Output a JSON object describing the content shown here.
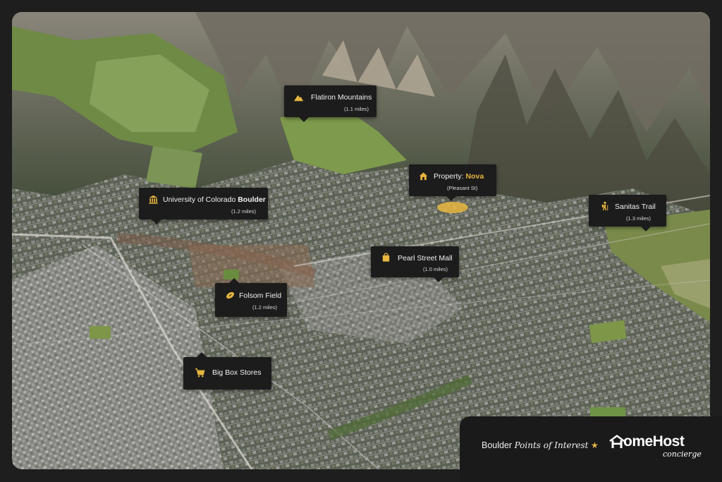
{
  "map": {
    "pins": [
      {
        "id": "flatiron",
        "title": "Flatiron Mountains",
        "distance": "(1.1 miles)",
        "icon": "mountain-icon"
      },
      {
        "id": "property",
        "title_prefix": "Property: ",
        "title_highlight": "Nova",
        "distance": "(Pleasant St)",
        "icon": "house-icon"
      },
      {
        "id": "cu",
        "title_prefix": "University of Colorado ",
        "title_highlight": "Boulder",
        "distance": "(1.2 miles)",
        "icon": "university-icon"
      },
      {
        "id": "sanitas",
        "title": "Sanitas Trail",
        "distance": "(1.3 miles)",
        "icon": "hiker-icon"
      },
      {
        "id": "pearl",
        "title": "Pearl Street Mall",
        "distance": "(1.0 miles)",
        "icon": "shopping-bag-icon"
      },
      {
        "id": "folsom",
        "title": "Folsom Field",
        "distance": "(1.2 miles)",
        "icon": "football-icon"
      },
      {
        "id": "bigbox",
        "title": "Big Box Stores",
        "distance": "",
        "icon": "shopping-cart-icon"
      }
    ]
  },
  "footer": {
    "caption_prefix": "Boulder",
    "caption_script": "Points of Interest",
    "caption_icon": "star-icon",
    "logo_main": "omeHost",
    "logo_script": "concierge",
    "logo_icon": "house-logo-icon"
  },
  "colors": {
    "background": "#1e1e1e",
    "callout": "#1c1c1c",
    "accent_gold": "#e6b63f"
  }
}
